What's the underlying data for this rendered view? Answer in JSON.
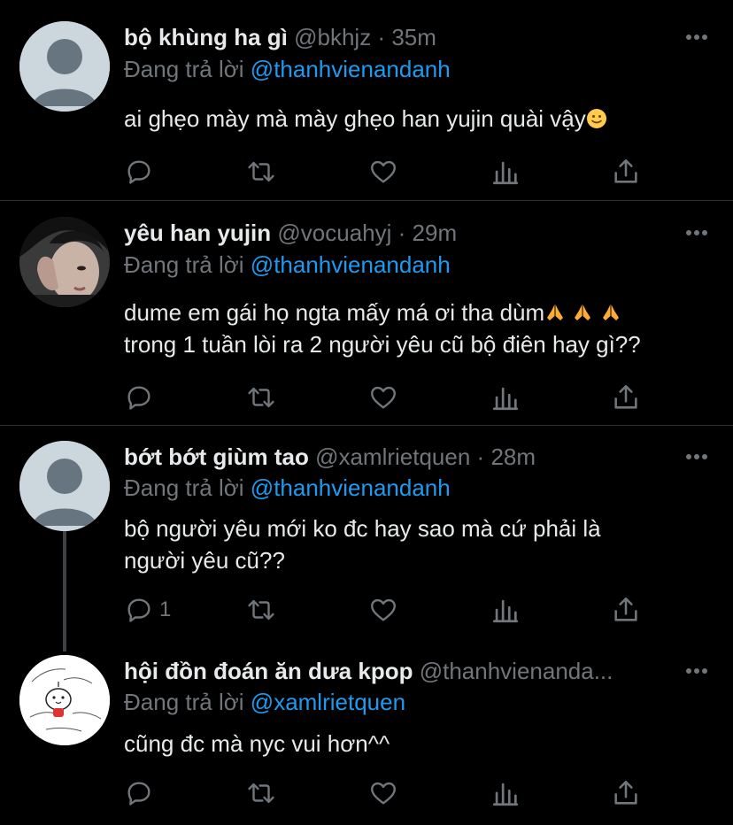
{
  "tweets": [
    {
      "name": "bộ khùng ha gì",
      "handle": "@bkhjz",
      "dot": "·",
      "time": "35m",
      "replying_prefix": "Đang trả lời",
      "replying_to": "@thanhvienandanh",
      "lines": [
        "ai ghẹo mày mà mày ghẹo han yujin quài vậy"
      ],
      "emoji": "slight-smile-emoji",
      "reply_count": ""
    },
    {
      "name": "yêu han yujin",
      "handle": "@vocuahyj",
      "dot": "·",
      "time": "29m",
      "replying_prefix": "Đang trả lời",
      "replying_to": "@thanhvienandanh",
      "lines": [
        "dume em gái họ ngta mấy má ơi tha dùm",
        "trong 1 tuần lòi ra 2 người yêu cũ bộ điên hay gì??"
      ],
      "emoji": "folded-hands-emoji",
      "reply_count": ""
    },
    {
      "name": "bớt bớt giùm tao",
      "handle": "@xamlrietquen",
      "dot": "·",
      "time": "28m",
      "replying_prefix": "Đang trả lời",
      "replying_to": "@thanhvienandanh",
      "lines": [
        "bộ người yêu mới ko đc hay sao mà cứ phải là",
        "người yêu cũ??"
      ],
      "emoji": "",
      "reply_count": "1"
    },
    {
      "name": "hội đồn đoán ăn dưa kpop",
      "handle": "@thanhvienanda...",
      "dot": "",
      "time": "",
      "replying_prefix": "Đang trả lời",
      "replying_to": "@xamlrietquen",
      "lines": [
        "cũng đc mà nyc vui hơn^^"
      ],
      "emoji": "",
      "reply_count": ""
    }
  ],
  "colors": {
    "background": "#000000",
    "text": "#e7e9ea",
    "muted": "#71767b",
    "link": "#1d9bf0",
    "separator": "#2f3336"
  }
}
